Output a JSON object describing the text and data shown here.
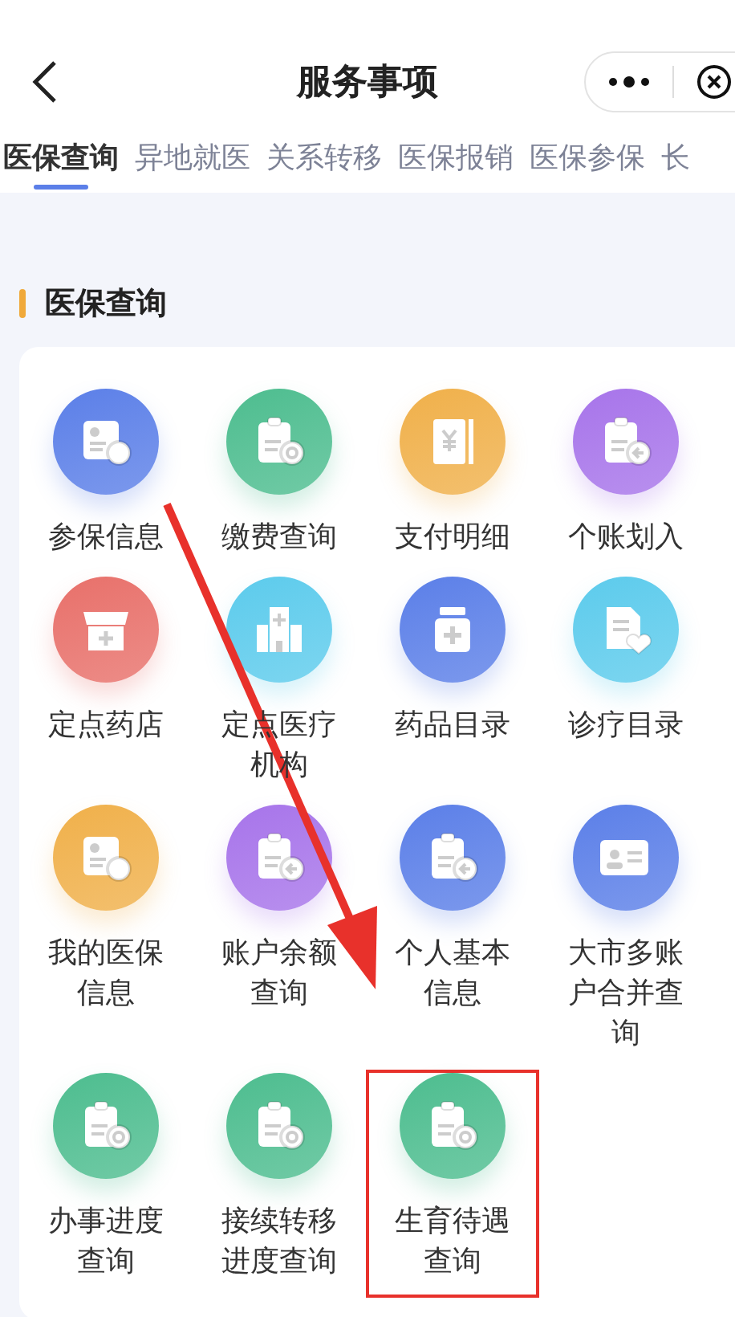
{
  "header": {
    "title": "服务事项"
  },
  "tabs": [
    {
      "label": "医保查询",
      "selected": true
    },
    {
      "label": "异地就医",
      "selected": false
    },
    {
      "label": "关系转移",
      "selected": false
    },
    {
      "label": "医保报销",
      "selected": false
    },
    {
      "label": "医保参保",
      "selected": false
    },
    {
      "label": "长",
      "selected": false
    }
  ],
  "section": {
    "title": "医保查询"
  },
  "items": [
    {
      "label": "参保信息",
      "kind": "card-coin",
      "color": "#5b7fe8",
      "highlighted": false
    },
    {
      "label": "缴费查询",
      "kind": "clipboard-search",
      "color": "#4dbd8f",
      "highlighted": false
    },
    {
      "label": "支付明细",
      "kind": "ledger",
      "color": "#f0b04a",
      "highlighted": false
    },
    {
      "label": "个账划入",
      "kind": "clipboard-back",
      "color": "#a774ea",
      "highlighted": false
    },
    {
      "label": "定点药店",
      "kind": "shop",
      "color": "#e8706a",
      "highlighted": false
    },
    {
      "label": "定点医疗机构",
      "kind": "hospital",
      "color": "#5ccbec",
      "highlighted": false
    },
    {
      "label": "药品目录",
      "kind": "medicine",
      "color": "#5b7fe8",
      "highlighted": false
    },
    {
      "label": "诊疗目录",
      "kind": "document-heart",
      "color": "#5ccbec",
      "highlighted": false
    },
    {
      "label": "我的医保信息",
      "kind": "card-coin",
      "color": "#f0b04a",
      "highlighted": false
    },
    {
      "label": "账户余额查询",
      "kind": "clipboard-back",
      "color": "#a774ea",
      "highlighted": false
    },
    {
      "label": "个人基本信息",
      "kind": "clipboard-back",
      "color": "#5b7fe8",
      "highlighted": false
    },
    {
      "label": "大市多账户合并查询",
      "kind": "id-card",
      "color": "#5b7fe8",
      "highlighted": false
    },
    {
      "label": "办事进度查询",
      "kind": "clipboard-search",
      "color": "#4dbd8f",
      "highlighted": false
    },
    {
      "label": "接续转移进度查询",
      "kind": "clipboard-search",
      "color": "#4dbd8f",
      "highlighted": false
    },
    {
      "label": "生育待遇查询",
      "kind": "clipboard-search",
      "color": "#4dbd8f",
      "highlighted": true
    }
  ]
}
